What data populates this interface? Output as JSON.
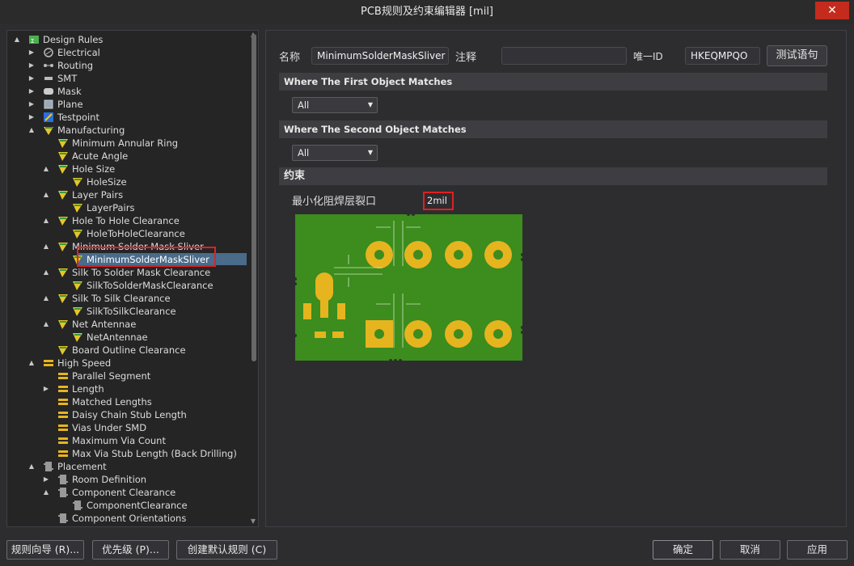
{
  "window": {
    "title": "PCB规则及约束编辑器 [mil]",
    "close_label": "✕"
  },
  "tree": [
    {
      "label": "Design Rules",
      "icon": "rules-root-icon"
    },
    {
      "label": "Electrical",
      "icon": "electrical-icon"
    },
    {
      "label": "Routing",
      "icon": "routing-icon"
    },
    {
      "label": "SMT",
      "icon": "smt-icon"
    },
    {
      "label": "Mask",
      "icon": "mask-icon"
    },
    {
      "label": "Plane",
      "icon": "plane-icon"
    },
    {
      "label": "Testpoint",
      "icon": "testpoint-icon"
    },
    {
      "label": "Manufacturing",
      "icon": "manufacturing-icon"
    },
    {
      "label": "Minimum Annular Ring",
      "icon": "rule-icon"
    },
    {
      "label": "Acute Angle",
      "icon": "rule-icon"
    },
    {
      "label": "Hole Size",
      "icon": "rule-icon"
    },
    {
      "label": "HoleSize",
      "icon": "rule-icon"
    },
    {
      "label": "Layer Pairs",
      "icon": "rule-icon"
    },
    {
      "label": "LayerPairs",
      "icon": "rule-icon"
    },
    {
      "label": "Hole To Hole Clearance",
      "icon": "rule-icon"
    },
    {
      "label": "HoleToHoleClearance",
      "icon": "rule-icon"
    },
    {
      "label": "Minimum Solder Mask Sliver",
      "icon": "rule-icon"
    },
    {
      "label": "MinimumSolderMaskSliver",
      "icon": "rule-icon"
    },
    {
      "label": "Silk To Solder Mask Clearance",
      "icon": "rule-icon"
    },
    {
      "label": "SilkToSolderMaskClearance",
      "icon": "rule-icon"
    },
    {
      "label": "Silk To Silk Clearance",
      "icon": "rule-icon"
    },
    {
      "label": "SilkToSilkClearance",
      "icon": "rule-icon"
    },
    {
      "label": "Net Antennae",
      "icon": "rule-icon"
    },
    {
      "label": "NetAntennae",
      "icon": "rule-icon"
    },
    {
      "label": "Board Outline Clearance",
      "icon": "rule-icon"
    },
    {
      "label": "High Speed",
      "icon": "highspeed-icon"
    },
    {
      "label": "Parallel Segment",
      "icon": "highspeed-rule-icon"
    },
    {
      "label": "Length",
      "icon": "highspeed-rule-icon"
    },
    {
      "label": "Matched Lengths",
      "icon": "highspeed-rule-icon"
    },
    {
      "label": "Daisy Chain Stub Length",
      "icon": "highspeed-rule-icon"
    },
    {
      "label": "Vias Under SMD",
      "icon": "highspeed-rule-icon"
    },
    {
      "label": "Maximum Via Count",
      "icon": "highspeed-rule-icon"
    },
    {
      "label": "Max Via Stub Length (Back Drilling)",
      "icon": "highspeed-rule-icon"
    },
    {
      "label": "Placement",
      "icon": "placement-icon"
    },
    {
      "label": "Room Definition",
      "icon": "placement-rule-icon"
    },
    {
      "label": "Component Clearance",
      "icon": "placement-rule-icon"
    },
    {
      "label": "ComponentClearance",
      "icon": "placement-rule-icon"
    },
    {
      "label": "Component Orientations",
      "icon": "placement-rule-icon"
    }
  ],
  "form": {
    "name_label": "名称",
    "name_value": "MinimumSolderMaskSliver",
    "comment_label": "注释",
    "comment_value": "",
    "uid_label": "唯一ID",
    "uid_value": "HKEQMPQO",
    "test_button": "测试语句"
  },
  "first_match": {
    "header": "Where The First Object Matches",
    "value": "All"
  },
  "second_match": {
    "header": "Where The Second Object Matches",
    "value": "All"
  },
  "constraints": {
    "header": "约束",
    "label": "最小化阻焊层裂口",
    "value": "2mil"
  },
  "bottom": {
    "wizard": "规则向导 (R)...",
    "priority": "优先级 (P)...",
    "create_default": "创建默认规则 (C)",
    "ok": "确定",
    "cancel": "取消",
    "apply": "应用"
  },
  "colors": {
    "pcb_green": "#3c8c1e",
    "pad_yellow": "#e6b41e",
    "selection": "#4a6b8a",
    "highlight_red": "#e02020"
  }
}
